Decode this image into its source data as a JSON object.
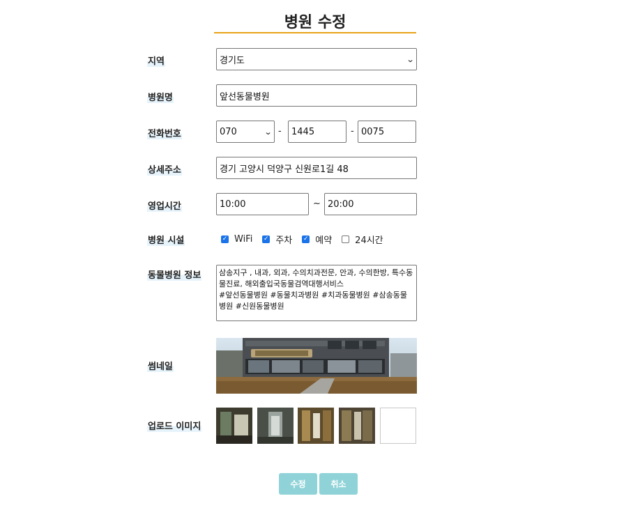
{
  "page": {
    "title": "병원 수정"
  },
  "labels": {
    "region": "지역",
    "name": "병원명",
    "phone": "전화번호",
    "address": "상세주소",
    "hours": "영업시간",
    "facilities": "병원 시설",
    "info": "동물병원 정보",
    "thumbnail": "썸네일",
    "upload": "업로드 이미지"
  },
  "form": {
    "region_value": "경기도",
    "name_value": "앞선동물병원",
    "phone_prefix": "070",
    "phone_mid": "1445",
    "phone_last": "0075",
    "phone_sep": "-",
    "address_value": "경기 고양시 덕양구 신원로1길 48",
    "hours_open": "10:00",
    "hours_close": "20:00",
    "hours_sep": "~",
    "info_value": "삼송지구 , 내과, 외과, 수의치과전문, 안과, 수의한방, 특수동물진료, 해외출입국동물검역대행서비스\n#앞선동물병원 #동물치과병원 #치과동물병원 #삼송동물병원 #신원동물병원"
  },
  "facilities": [
    {
      "label": "WiFi",
      "checked": true
    },
    {
      "label": "주차",
      "checked": true
    },
    {
      "label": "예약",
      "checked": true
    },
    {
      "label": "24시간",
      "checked": false
    }
  ],
  "buttons": {
    "submit": "수정",
    "cancel": "취소"
  },
  "colors": {
    "accent_line": "#e8a317",
    "button_bg": "#8fd3d8",
    "checkbox": "#1a73e8"
  }
}
